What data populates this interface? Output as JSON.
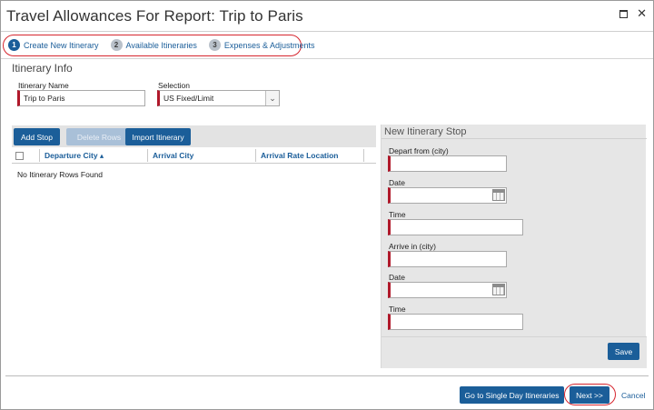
{
  "window": {
    "title": "Travel Allowances For Report: Trip to Paris"
  },
  "steps": [
    {
      "num": "1",
      "label": "Create New Itinerary"
    },
    {
      "num": "2",
      "label": "Available Itineraries"
    },
    {
      "num": "3",
      "label": "Expenses & Adjustments"
    }
  ],
  "itinerary_info": {
    "heading": "Itinerary Info",
    "name_label": "Itinerary Name",
    "name_value": "Trip to Paris",
    "selection_label": "Selection",
    "selection_value": "US Fixed/Limit"
  },
  "toolbar": {
    "add_stop": "Add Stop",
    "delete_rows": "Delete Rows",
    "import_itinerary": "Import Itinerary"
  },
  "grid": {
    "columns": [
      "Departure City ▴",
      "Arrival City",
      "Arrival Rate Location"
    ],
    "empty_message": "No Itinerary Rows Found"
  },
  "new_stop": {
    "heading": "New Itinerary Stop",
    "depart_label": "Depart from (city)",
    "date_label_1": "Date",
    "time_label_1": "Time",
    "arrive_label": "Arrive in (city)",
    "date_label_2": "Date",
    "time_label_2": "Time",
    "save": "Save"
  },
  "footer": {
    "single_day": "Go to Single Day Itineraries",
    "next": "Next >>",
    "cancel": "Cancel"
  },
  "colors": {
    "accent": "#1b5e99",
    "required_bar": "#b0182a",
    "highlight_oval": "#d6252e"
  }
}
